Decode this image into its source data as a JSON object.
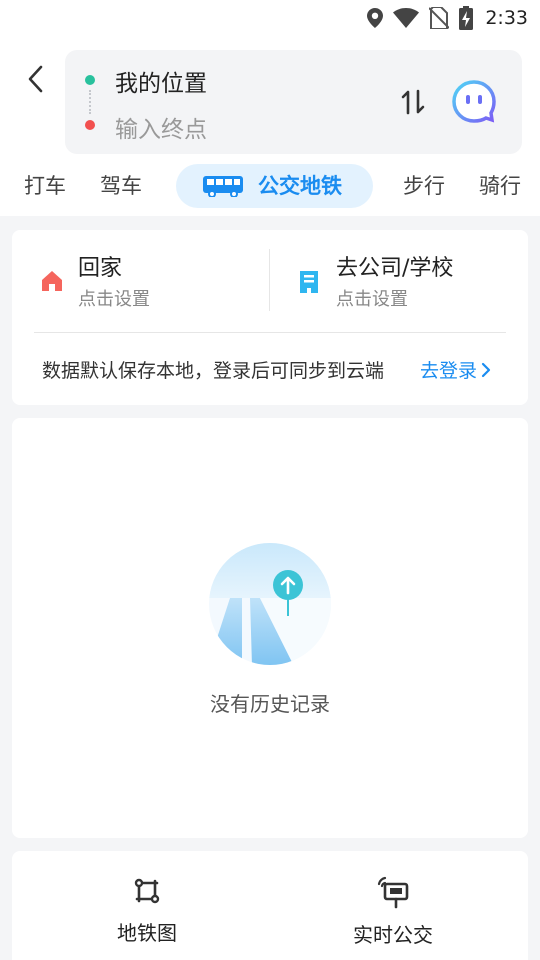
{
  "status_bar": {
    "time": "2:33"
  },
  "route": {
    "from": "我的位置",
    "to_placeholder": "输入终点"
  },
  "tabs": [
    {
      "label": "打车"
    },
    {
      "label": "驾车"
    },
    {
      "label": "公交地铁",
      "active": true
    },
    {
      "label": "步行"
    },
    {
      "label": "骑行"
    }
  ],
  "favorites": {
    "home": {
      "title": "回家",
      "subtitle": "点击设置",
      "icon": "home-icon",
      "color": "#f5655d"
    },
    "work": {
      "title": "去公司/学校",
      "subtitle": "点击设置",
      "icon": "office-icon",
      "color": "#2fb6f0"
    }
  },
  "sync": {
    "notice": "数据默认保存本地，登录后可同步到云端",
    "login_label": "去登录"
  },
  "history": {
    "empty_text": "没有历史记录"
  },
  "tools": [
    {
      "label": "地铁图",
      "icon": "subway-map-icon"
    },
    {
      "label": "实时公交",
      "icon": "realtime-bus-icon"
    }
  ],
  "colors": {
    "accent": "#1a8cf0",
    "start_dot": "#28c19d",
    "end_dot": "#f2504f",
    "active_tab_bg": "#e3f2fe"
  }
}
